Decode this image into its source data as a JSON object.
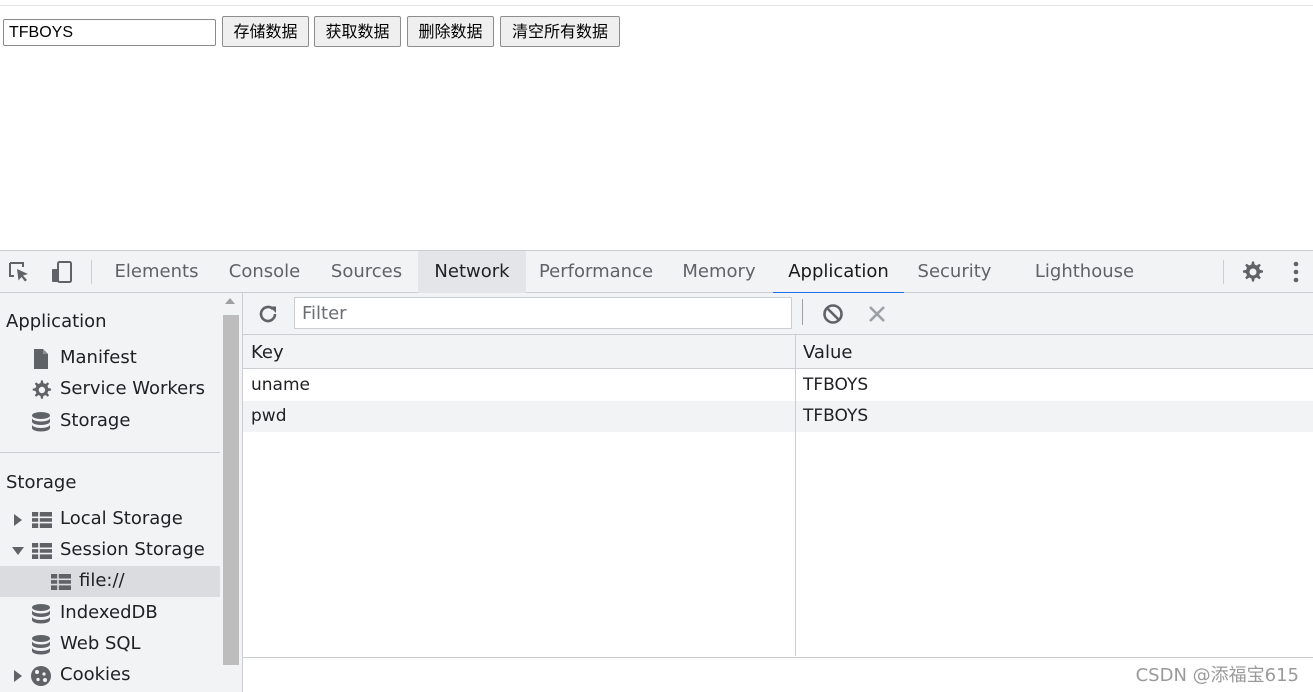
{
  "page": {
    "input_value": "TFBOYS",
    "buttons": [
      {
        "label": "存储数据"
      },
      {
        "label": "获取数据"
      },
      {
        "label": "删除数据"
      },
      {
        "label": "清空所有数据"
      }
    ]
  },
  "devtools": {
    "toolbar_icons": [
      "inspect-element-icon",
      "device-toggle-icon",
      "settings-gear-icon",
      "more-menu-icon"
    ],
    "tabs": [
      {
        "label": "Elements"
      },
      {
        "label": "Console"
      },
      {
        "label": "Sources"
      },
      {
        "label": "Network"
      },
      {
        "label": "Performance"
      },
      {
        "label": "Memory"
      },
      {
        "label": "Application"
      },
      {
        "label": "Security"
      },
      {
        "label": "Lighthouse"
      }
    ],
    "active_tab": "Application",
    "hovered_tab": "Network",
    "accent_color": "#1a73e8",
    "sidebar": {
      "application_header": "Application",
      "application_items": [
        {
          "label": "Manifest",
          "icon": "file-icon"
        },
        {
          "label": "Service Workers",
          "icon": "gear-icon"
        },
        {
          "label": "Storage",
          "icon": "database-icon"
        }
      ],
      "storage_header": "Storage",
      "storage_items": [
        {
          "label": "Local Storage",
          "icon": "grid-table-icon",
          "expander": "collapsed"
        },
        {
          "label": "Session Storage",
          "icon": "grid-table-icon",
          "expander": "expanded"
        },
        {
          "label": "file://",
          "icon": "grid-table-icon",
          "selected": true
        },
        {
          "label": "IndexedDB",
          "icon": "database-icon"
        },
        {
          "label": "Web SQL",
          "icon": "database-icon"
        },
        {
          "label": "Cookies",
          "icon": "cookie-icon",
          "expander": "collapsed"
        }
      ]
    },
    "storage_view": {
      "toolbar_icons": [
        "refresh-icon",
        "clear-all-icon",
        "delete-selected-icon"
      ],
      "filter_placeholder": "Filter",
      "columns": [
        "Key",
        "Value"
      ],
      "rows": [
        {
          "key": "uname",
          "value": "TFBOYS"
        },
        {
          "key": "pwd",
          "value": "TFBOYS"
        }
      ]
    }
  },
  "watermark": "CSDN @添福宝615"
}
